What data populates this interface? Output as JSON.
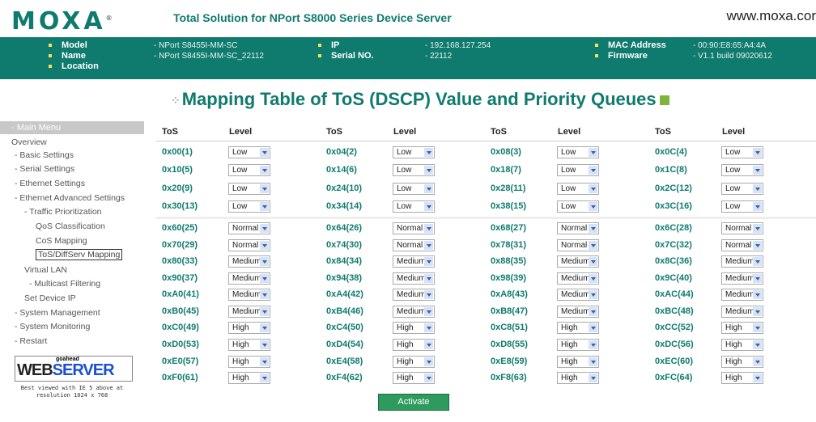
{
  "header": {
    "logo": "MOXA",
    "tagline": "Total Solution for NPort S8000 Series Device Server",
    "site": "www.moxa.cor"
  },
  "info": {
    "model_label": "Model",
    "model_value": "- NPort S8455I-MM-SC",
    "name_label": "Name",
    "name_value": "- NPort S8455I-MM-SC_22112",
    "location_label": "Location",
    "ip_label": "IP",
    "ip_value": "- 192.168.127.254",
    "serial_label": "Serial NO.",
    "serial_value": "- 22112",
    "mac_label": "MAC Address",
    "mac_value": "- 00:90:E8:65:A4:4A",
    "firmware_label": "Firmware",
    "firmware_value": "- V1.1 build 09020612"
  },
  "page": {
    "title": "Mapping Table of ToS (DSCP) Value and Priority Queues",
    "activate": "Activate"
  },
  "menu": {
    "head": "- Main Menu",
    "items": [
      "Overview",
      "- Basic Settings",
      "- Serial Settings",
      "- Ethernet Settings",
      "- Ethernet Advanced Settings",
      "- Traffic Prioritization",
      "QoS Classification",
      "CoS Mapping",
      "ToS/DiffServ Mapping",
      "Virtual LAN",
      "- Multicast Filtering",
      "Set Device IP",
      "- System Management",
      "- System Monitoring",
      "- Restart"
    ],
    "selected": "ToS/DiffServ Mapping",
    "badge_top": "goahead",
    "badge_web": "WEB",
    "badge_server": "SERVER",
    "best_view_1": "Best viewed with IE 5 above at",
    "best_view_2": "resolution 1024 x 768"
  },
  "table": {
    "headers": {
      "tos": "ToS",
      "level": "Level"
    },
    "rows": [
      [
        [
          "0x00(1)",
          "Low"
        ],
        [
          "0x04(2)",
          "Low"
        ],
        [
          "0x08(3)",
          "Low"
        ],
        [
          "0x0C(4)",
          "Low"
        ]
      ],
      [
        [
          "0x10(5)",
          "Low"
        ],
        [
          "0x14(6)",
          "Low"
        ],
        [
          "0x18(7)",
          "Low"
        ],
        [
          "0x1C(8)",
          "Low"
        ]
      ],
      [
        [
          "0x20(9)",
          "Low"
        ],
        [
          "0x24(10)",
          "Low"
        ],
        [
          "0x28(11)",
          "Low"
        ],
        [
          "0x2C(12)",
          "Low"
        ]
      ],
      [
        [
          "0x30(13)",
          "Low"
        ],
        [
          "0x34(14)",
          "Low"
        ],
        [
          "0x38(15)",
          "Low"
        ],
        [
          "0x3C(16)",
          "Low"
        ]
      ],
      [
        [
          "0x60(25)",
          "Normal"
        ],
        [
          "0x64(26)",
          "Normal"
        ],
        [
          "0x68(27)",
          "Normal"
        ],
        [
          "0x6C(28)",
          "Normal"
        ]
      ],
      [
        [
          "0x70(29)",
          "Normal"
        ],
        [
          "0x74(30)",
          "Normal"
        ],
        [
          "0x78(31)",
          "Normal"
        ],
        [
          "0x7C(32)",
          "Normal"
        ]
      ],
      [
        [
          "0x80(33)",
          "Medium"
        ],
        [
          "0x84(34)",
          "Medium"
        ],
        [
          "0x88(35)",
          "Medium"
        ],
        [
          "0x8C(36)",
          "Medium"
        ]
      ],
      [
        [
          "0x90(37)",
          "Medium"
        ],
        [
          "0x94(38)",
          "Medium"
        ],
        [
          "0x98(39)",
          "Medium"
        ],
        [
          "0x9C(40)",
          "Medium"
        ]
      ],
      [
        [
          "0xA0(41)",
          "Medium"
        ],
        [
          "0xA4(42)",
          "Medium"
        ],
        [
          "0xA8(43)",
          "Medium"
        ],
        [
          "0xAC(44)",
          "Medium"
        ]
      ],
      [
        [
          "0xB0(45)",
          "Medium"
        ],
        [
          "0xB4(46)",
          "Medium"
        ],
        [
          "0xB8(47)",
          "Medium"
        ],
        [
          "0xBC(48)",
          "Medium"
        ]
      ],
      [
        [
          "0xC0(49)",
          "High"
        ],
        [
          "0xC4(50)",
          "High"
        ],
        [
          "0xC8(51)",
          "High"
        ],
        [
          "0xCC(52)",
          "High"
        ]
      ],
      [
        [
          "0xD0(53)",
          "High"
        ],
        [
          "0xD4(54)",
          "High"
        ],
        [
          "0xD8(55)",
          "High"
        ],
        [
          "0xDC(56)",
          "High"
        ]
      ],
      [
        [
          "0xE0(57)",
          "High"
        ],
        [
          "0xE4(58)",
          "High"
        ],
        [
          "0xE8(59)",
          "High"
        ],
        [
          "0xEC(60)",
          "High"
        ]
      ],
      [
        [
          "0xF0(61)",
          "High"
        ],
        [
          "0xF4(62)",
          "High"
        ],
        [
          "0xF8(63)",
          "High"
        ],
        [
          "0xFC(64)",
          "High"
        ]
      ]
    ]
  }
}
